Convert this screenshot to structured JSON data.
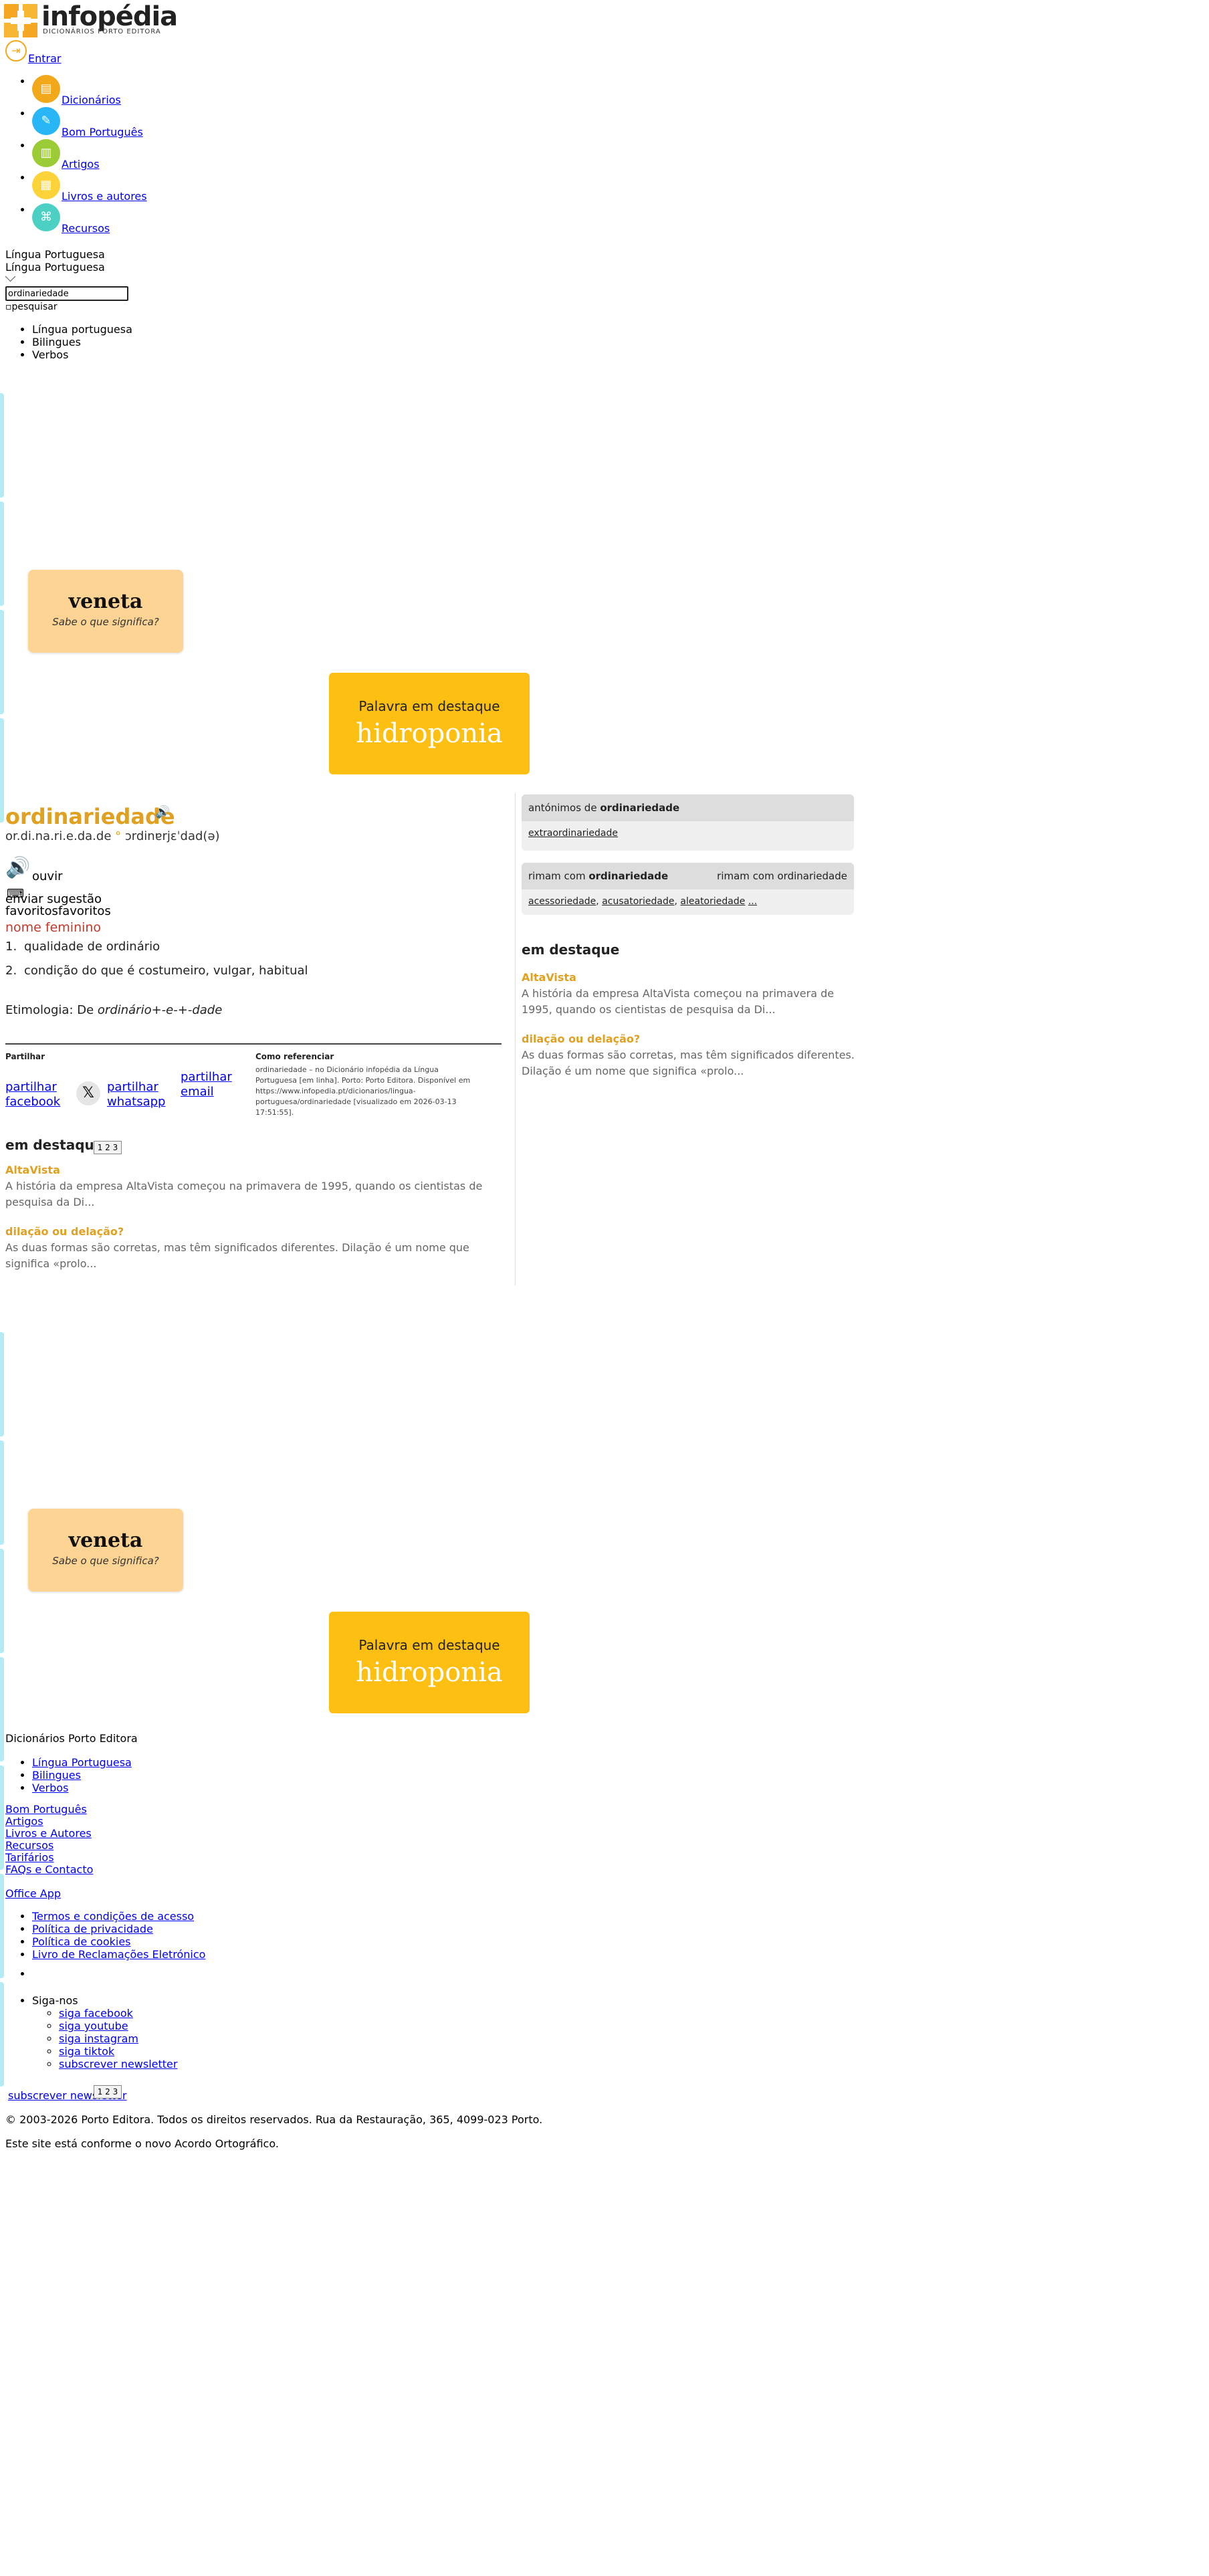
{
  "header": {
    "logo_title": "infopédia",
    "logo_subtitle": "DICIONÁRIOS PORTO EDITORA",
    "login_label": "Entrar"
  },
  "nav": [
    {
      "label": "Dicionários",
      "color": "#f1a81b"
    },
    {
      "label": "Bom Português",
      "color": "#29b6f6"
    },
    {
      "label": "Artigos",
      "color": "#9ccc35"
    },
    {
      "label": "Livros e autores",
      "color": "#fdd33a"
    },
    {
      "label": "Recursos",
      "color": "#4dd0c4"
    }
  ],
  "search": {
    "language_1": "Língua Portuguesa",
    "language_2": "Língua Portuguesa",
    "query": "ordinariedade",
    "button_label": "pesquisar",
    "dictionaries": [
      "Língua portuguesa",
      "Bilingues",
      "Verbos"
    ]
  },
  "banners": {
    "word_of_day": "veneta",
    "word_of_day_sub": "Sabe o que significa?",
    "featured_label": "Palavra em destaque",
    "featured_word": "hidroponia"
  },
  "entry": {
    "headword": "ordinariedade",
    "syllabification": "or.di.na.ri.e.da.de",
    "pronunciation": "ɔrdinɐrjɛˈdad(ə)",
    "listen_label": "ouvir",
    "suggest_label": "enviar sugestão",
    "favorites_label": "favoritosfavoritos",
    "part_of_speech": "nome feminino",
    "definitions": [
      {
        "num": "1.",
        "text": "qualidade de ordinário"
      },
      {
        "num": "2.",
        "text": "condição do que é costumeiro, vulgar, habitual"
      }
    ],
    "etymology_prefix": "Etimologia: De ",
    "etymology_value": "ordinário+-e-+-dade"
  },
  "share": {
    "title": "Partilhar",
    "facebook": "partilhar facebook",
    "whatsapp": "partilhar whatsapp",
    "email": "partilhar email",
    "cite_title": "Como referenciar",
    "cite_text": "ordinariedade – no Dicionário infopédia da Língua Portuguesa [em linha]. Porto: Porto Editora. Disponível em https://www.infopedia.pt/dicionarios/lingua-portuguesa/ordinariedade [visualizado em 2026-03-13 17:51:55]."
  },
  "em_destaque": {
    "title": "em destaque",
    "items": [
      {
        "title": "AltaVista",
        "text": "A história da empresa AltaVista começou na primavera de 1995, quando os cientistas de pesquisa da Di..."
      },
      {
        "title": "dilação ou delação?",
        "text": "As duas formas são corretas, mas têm significados diferentes. Dilação é um nome que significa «prolo..."
      }
    ],
    "pager": "1 2 3"
  },
  "sidebar": {
    "antonyms_prefix": "antónimos de ",
    "antonyms_word": "ordinariedade",
    "antonyms_values": "extraordinariedade",
    "rhymes_prefix": "rimam com ",
    "rhymes_word": "ordinariedade",
    "rhymes_img_alt": "rimam com ordinariedade",
    "rhymes_values": [
      "acessoriedade",
      "acusatoriedade",
      "aleatoriedade",
      "..."
    ]
  },
  "footer": {
    "title": "Dicionários Porto Editora",
    "dict_links": [
      "Língua Portuguesa",
      "Bilingues",
      "Verbos"
    ],
    "links": [
      "Bom Português",
      "Artigos",
      "Livros e Autores",
      "Recursos",
      "Tarifários",
      "FAQs e Contacto"
    ],
    "office_app": "Office App",
    "legal": [
      "Termos e condições de acesso",
      "Política de privacidade",
      "Política de cookies",
      "Livro de Reclamações Eletrónico"
    ],
    "follow_label": "Siga-nos",
    "social": [
      "siga facebook",
      "siga youtube",
      "siga instagram",
      "siga tiktok",
      "subscrever newsletter"
    ],
    "subscribe_label": "subscrever newsletter",
    "pager": "1 2 3",
    "copyright": "© 2003-2026 Porto Editora. Todos os direitos reservados. Rua da Restauração, 365, 4099-023 Porto.",
    "acordo": "Este site está conforme o novo Acordo Ortográfico."
  }
}
